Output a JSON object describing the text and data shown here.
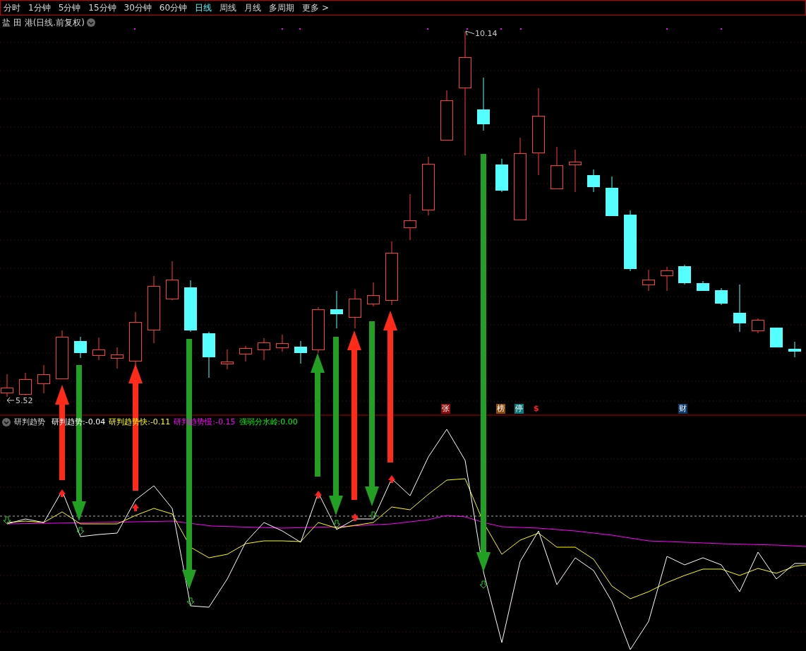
{
  "menu": [
    {
      "label": "分时",
      "selected": false
    },
    {
      "label": "1分钟",
      "selected": false
    },
    {
      "label": "5分钟",
      "selected": false
    },
    {
      "label": "15分钟",
      "selected": false
    },
    {
      "label": "30分钟",
      "selected": false
    },
    {
      "label": "60分钟",
      "selected": false
    },
    {
      "label": "日线",
      "selected": true
    },
    {
      "label": "周线",
      "selected": false
    },
    {
      "label": "月线",
      "selected": false
    },
    {
      "label": "多周期",
      "selected": false
    },
    {
      "label": "更多 >",
      "selected": false
    }
  ],
  "title": "盐 田 港(日线.前复权)",
  "price_labels": {
    "high": "10.14",
    "low": "5.52"
  },
  "events": [
    {
      "label": "张",
      "kind": "badge",
      "color": "#8b0a0a"
    },
    {
      "label": "榜",
      "kind": "badge",
      "color": "#8a4a0c"
    },
    {
      "label": "停",
      "kind": "badge",
      "color": "#0a7a7a"
    },
    {
      "label": "$",
      "kind": "mark",
      "color": "#ff2020"
    },
    {
      "label": "财",
      "kind": "badge",
      "color": "#0c3a6a"
    }
  ],
  "indicator": {
    "name": "研判趋势",
    "values": [
      {
        "text": "研判趋势:-0.04",
        "color": "#ffffff"
      },
      {
        "text": "研判趋势快:-0.11",
        "color": "#ffff00"
      },
      {
        "text": "研判趋势慢:-0.15",
        "color": "#ff00ff"
      },
      {
        "text": "强弱分水岭:0.00",
        "color": "#00ff00"
      }
    ]
  }
}
